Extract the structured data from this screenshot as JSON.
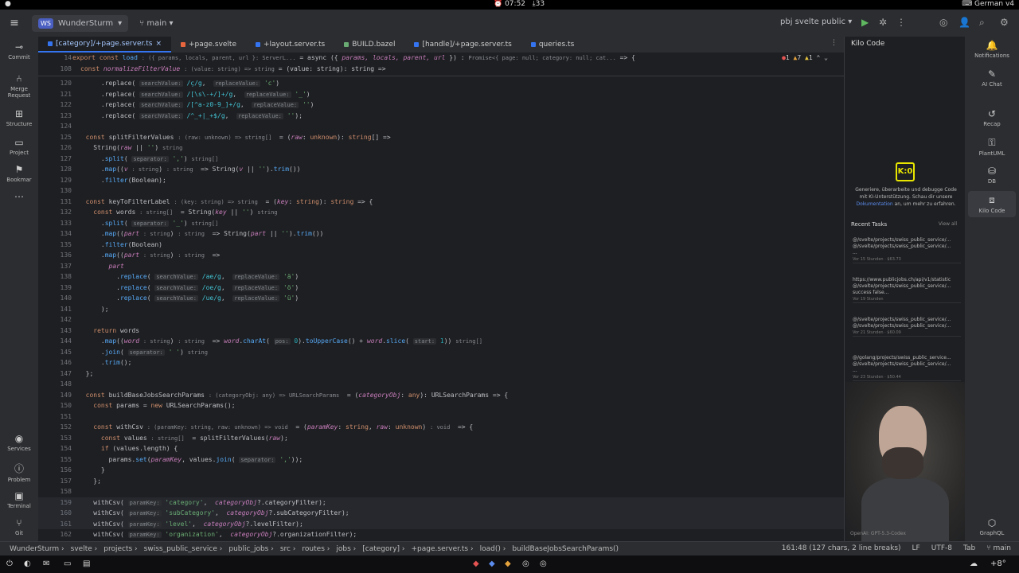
{
  "system_bar": {
    "clock": "07:52",
    "downloads": "33",
    "keyboard": "German v4"
  },
  "titlebar": {
    "project_badge": "WS",
    "project_name": "WunderSturm",
    "branch": "main",
    "run_config": "pbj svelte public"
  },
  "left_tools": [
    {
      "name": "commit",
      "label": "Commit",
      "icon": "commit-icon"
    },
    {
      "name": "merge-requests",
      "label": "Merge Request",
      "icon": "merge-icon"
    },
    {
      "name": "structure",
      "label": "Structure",
      "icon": "structure-icon"
    },
    {
      "name": "project",
      "label": "Project",
      "icon": "folder-icon"
    },
    {
      "name": "bookmarks",
      "label": "Bookmar",
      "icon": "bookmark-icon"
    },
    {
      "name": "services",
      "label": "Services",
      "icon": "services-icon"
    },
    {
      "name": "problems",
      "label": "Problem",
      "icon": "problems-icon"
    },
    {
      "name": "terminal",
      "label": "Terminal",
      "icon": "terminal-icon"
    },
    {
      "name": "git",
      "label": "Git",
      "icon": "git-icon"
    }
  ],
  "tabs": [
    {
      "label": "[category]/+page.server.ts",
      "color": "#3574f0",
      "active": true
    },
    {
      "label": "+page.svelte",
      "color": "#e8663d"
    },
    {
      "label": "+layout.server.ts",
      "color": "#3574f0"
    },
    {
      "label": "BUILD.bazel",
      "color": "#6aab73"
    },
    {
      "label": "[handle]/+page.server.ts",
      "color": "#3574f0"
    },
    {
      "label": "queries.ts",
      "color": "#3574f0"
    }
  ],
  "sticky": {
    "line1_no": "14",
    "line1_a": "export const",
    "line1_fn": "load",
    "line1_hint": ": ({ params, locals, parent, url }: ServerL...",
    "line1_b": "= async ({",
    "line1_params": "params, locals, parent, url",
    "line1_c": "}) :",
    "line1_ret": "Promise<{ page: null; category: null; cat...",
    "line1_d": "=> {",
    "line2_no": "108",
    "line2_a": "const",
    "line2_fn": "normalizeFilterValue",
    "line2_hint": ": (value: string) => string",
    "line2_b": "= (value: string): string =>",
    "errors": "1",
    "warnings": "7",
    "infos": "1"
  },
  "code_lines": [
    {
      "no": "120",
      "html_key": "l120"
    },
    {
      "no": "121"
    },
    {
      "no": "122"
    },
    {
      "no": "123"
    },
    {
      "no": "124"
    }
  ],
  "right_panel": {
    "title": "Kilo Code",
    "logo_text": "K:0",
    "desc_a": "Generiere, überarbeite und debugge Code mit KI-Unterstützung. Schau dir unsere",
    "desc_link": "Dokumentation",
    "desc_b": "an, um mehr zu erfahren.",
    "recent_title": "Recent Tasks",
    "view_all": "View all",
    "tasks": [
      {
        "l1": "@/svelte/projects/swiss_public_service/...",
        "l2": "@/svelte/projects/swiss_public_service/...",
        "l3": "...",
        "meta": "Vor 15 Stunden · $63.73"
      },
      {
        "l1": "https://www.publicjobs.ch/api/v1/statistic",
        "l2": "@/svelte/projects/swiss_public_service/...",
        "l3": "success   false...",
        "meta": "Vor 19 Stunden"
      },
      {
        "l1": "@/svelte/projects/swiss_public_service/...",
        "l2": "@/svelte/projects/swiss_public_service/...",
        "l3": "",
        "meta": "Vor 21 Stunden · $60.09"
      },
      {
        "l1": "@/golang/projects/swiss_public_service...",
        "l2": "@/svelte/projects/swiss_public_service/...",
        "l3": "...",
        "meta": "Vor 23 Stunden · $50.44"
      }
    ],
    "footer": "OpenAI: GPT-5.3-Codex"
  },
  "right_tools": [
    {
      "label": "Notifications",
      "icon": "bell-icon"
    },
    {
      "label": "AI Chat",
      "icon": "chat-icon"
    },
    {
      "label": "Recap",
      "icon": "recap-icon"
    },
    {
      "label": "PlantUML",
      "icon": "plantuml-icon"
    },
    {
      "label": "DB",
      "icon": "database-icon"
    },
    {
      "label": "Kilo Code",
      "icon": "kilo-icon"
    },
    {
      "label": "GraphQL",
      "icon": "graphql-icon"
    }
  ],
  "status": {
    "crumbs": [
      "WunderSturm",
      "svelte",
      "projects",
      "swiss_public_service",
      "public_jobs",
      "src",
      "routes",
      "jobs",
      "[category]",
      "+page.server.ts",
      "load()",
      "buildBaseJobsSearchParams()"
    ],
    "position": "161:48 (127 chars, 2 line breaks)",
    "line_ending": "LF",
    "encoding": "UTF-8",
    "indent": "Tab",
    "branch": "main"
  },
  "taskbar": {
    "weather": "+8°"
  }
}
